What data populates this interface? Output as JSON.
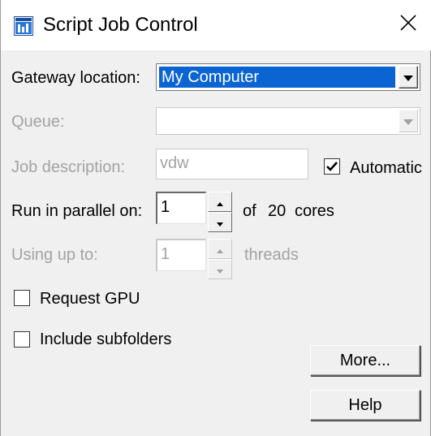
{
  "window": {
    "title": "Script Job Control",
    "icon": "app-window-icon",
    "close_icon": "close-icon"
  },
  "gateway": {
    "label": "Gateway location:",
    "value": "My Computer"
  },
  "queue": {
    "label": "Queue:",
    "value": ""
  },
  "job_description": {
    "label": "Job description:",
    "value": "vdw",
    "automatic_label": "Automatic",
    "automatic_checked": true
  },
  "parallel": {
    "label": "Run in parallel on:",
    "value": "1",
    "of_label": "of",
    "cores_count": "20",
    "cores_label": "cores"
  },
  "threads": {
    "label": "Using up to:",
    "value": "1",
    "suffix": "threads"
  },
  "request_gpu": {
    "label": "Request GPU",
    "checked": false
  },
  "include_subfolders": {
    "label": "Include subfolders",
    "checked": false
  },
  "buttons": {
    "more": "More...",
    "help": "Help"
  },
  "colors": {
    "selection": "#0a64d2",
    "disabled_text": "#a3a3a3",
    "dialog_bg": "#f0f0f0"
  }
}
